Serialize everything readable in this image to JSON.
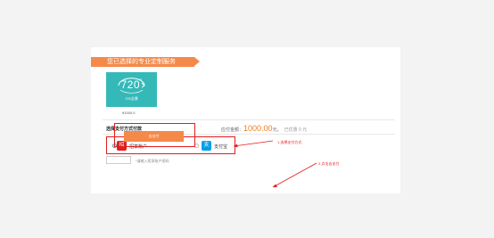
{
  "header": {
    "title": "您已选择的专业定制服务"
  },
  "service": {
    "name": "720全景",
    "degree": "720",
    "degree_sup": "°",
    "price": "¥1000.0"
  },
  "payment": {
    "section_title": "选择支付方式付款",
    "amount_label": "应付金额：",
    "amount_value": "1000.00",
    "amount_unit": "元，",
    "saved_text": "已优惠 0 元",
    "options": [
      {
        "label": "招享账户",
        "icon": "bank-icon",
        "selected": true
      },
      {
        "label": "支付宝",
        "icon": "alipay-icon",
        "selected": false
      }
    ],
    "code_placeholder": "",
    "code_hint": "*请输入招享账户密码",
    "pay_button": "去支付"
  },
  "annotations": {
    "step1": "1.选择支付方式",
    "step2": "2.点击去支付"
  },
  "colors": {
    "accent": "#f5894a",
    "annotation": "#e21d1d",
    "tile": "#35b9b8"
  }
}
